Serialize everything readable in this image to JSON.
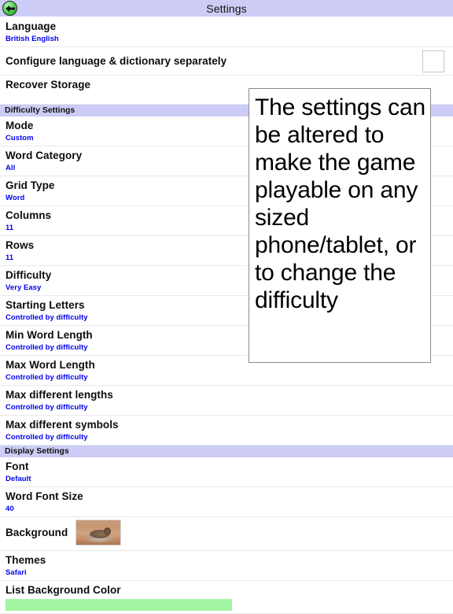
{
  "titlebar": {
    "title": "Settings",
    "back_icon": "back-arrow-icon"
  },
  "general": {
    "rows": [
      {
        "label": "Language",
        "value": "British English"
      }
    ],
    "checkbox_row": {
      "label": "Configure language & dictionary separately",
      "checked": false
    },
    "recover_row": {
      "label": "Recover Storage"
    }
  },
  "difficulty_settings": {
    "header": "Difficulty Settings",
    "rows": [
      {
        "label": "Mode",
        "value": "Custom"
      },
      {
        "label": "Word Category",
        "value": "All"
      },
      {
        "label": "Grid Type",
        "value": "Word"
      },
      {
        "label": "Columns",
        "value": "11"
      },
      {
        "label": "Rows",
        "value": "11"
      },
      {
        "label": "Difficulty",
        "value": "Very Easy"
      },
      {
        "label": "Starting Letters",
        "value": "Controlled by difficulty"
      },
      {
        "label": "Min Word Length",
        "value": "Controlled by difficulty"
      },
      {
        "label": "Max Word Length",
        "value": "Controlled by difficulty"
      },
      {
        "label": "Max different lengths",
        "value": "Controlled by difficulty"
      },
      {
        "label": "Max different symbols",
        "value": "Controlled by difficulty"
      }
    ]
  },
  "display_settings": {
    "header": "Display Settings",
    "rows": [
      {
        "label": "Font",
        "value": "Default"
      },
      {
        "label": "Word Font Size",
        "value": "40"
      }
    ],
    "background_row": {
      "label": "Background",
      "thumbnail": "safari-animal-thumbnail"
    },
    "themes_row": {
      "label": "Themes",
      "value": "Safari"
    },
    "list_background_color_row": {
      "label": "List Background Color",
      "color": "#a3f5a3"
    }
  },
  "callout": {
    "text": "The settings can be altered to make the game playable on any sized phone/tablet, or to change the difficulty"
  },
  "colors": {
    "accent_bar": "#ccccf6",
    "value_text": "#0000ee",
    "swatch_green": "#a3f5a3"
  }
}
